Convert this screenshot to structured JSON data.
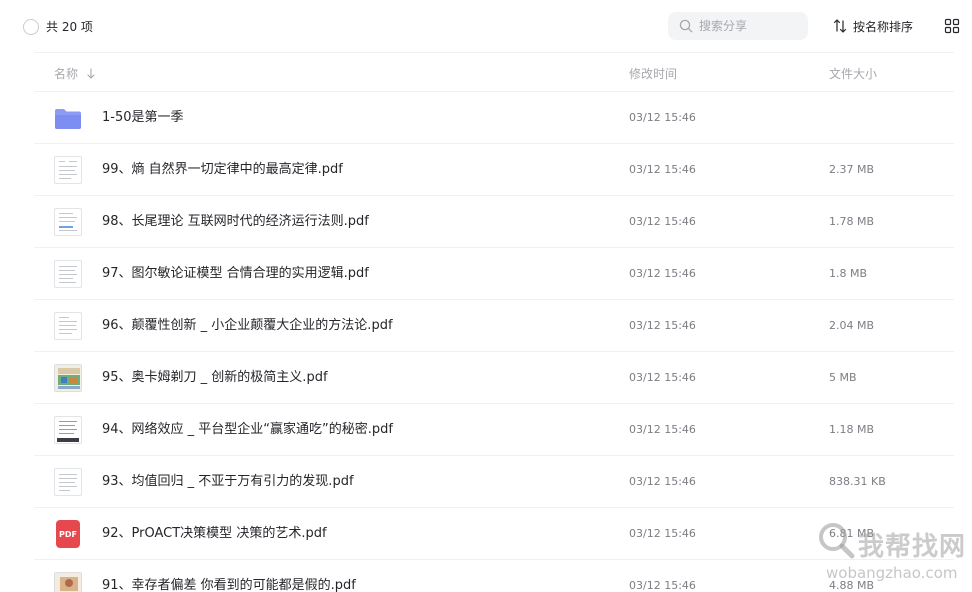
{
  "toolbar": {
    "count_label": "共 20 项",
    "search_placeholder": "搜索分享",
    "sort_label": "按名称排序"
  },
  "columns": {
    "name": "名称",
    "time": "修改时间",
    "size": "文件大小"
  },
  "files": [
    {
      "name": "1-50是第一季",
      "time": "03/12 15:46",
      "size": "",
      "icon": "folder-icon"
    },
    {
      "name": "99、熵 自然界一切定律中的最高定律.pdf",
      "time": "03/12 15:46",
      "size": "2.37 MB",
      "icon": "document-thumbnail-icon"
    },
    {
      "name": "98、长尾理论 互联网时代的经济运行法则.pdf",
      "time": "03/12 15:46",
      "size": "1.78 MB",
      "icon": "document-thumbnail-icon"
    },
    {
      "name": "97、图尔敏论证模型 合情合理的实用逻辑.pdf",
      "time": "03/12 15:46",
      "size": "1.8 MB",
      "icon": "document-thumbnail-icon"
    },
    {
      "name": "96、颠覆性创新 _ 小企业颠覆大企业的方法论.pdf",
      "time": "03/12 15:46",
      "size": "2.04 MB",
      "icon": "document-thumbnail-icon"
    },
    {
      "name": "95、奥卡姆剃刀 _ 创新的极简主义.pdf",
      "time": "03/12 15:46",
      "size": "5 MB",
      "icon": "photo-thumbnail-icon"
    },
    {
      "name": "94、网络效应 _ 平台型企业“赢家通吃”的秘密.pdf",
      "time": "03/12 15:46",
      "size": "1.18 MB",
      "icon": "document-thumbnail-icon"
    },
    {
      "name": "93、均值回归 _ 不亚于万有引力的发现.pdf",
      "time": "03/12 15:46",
      "size": "838.31 KB",
      "icon": "document-thumbnail-icon"
    },
    {
      "name": "92、PrOACT决策模型 决策的艺术.pdf",
      "time": "03/12 15:46",
      "size": "6.81 MB",
      "icon": "pdf-icon"
    },
    {
      "name": "91、幸存者偏差 你看到的可能都是假的.pdf",
      "time": "03/12 15:46",
      "size": "4.88 MB",
      "icon": "photo-thumbnail-icon"
    }
  ],
  "pdf_badge": "PDF",
  "watermark": {
    "text": "我帮找网",
    "url": "wobangzhao.com"
  },
  "colors": {
    "folder": "#8c9cf5",
    "pdf": "#e5484d",
    "text": "#25262b",
    "muted": "#a6a8ad",
    "divider": "#eef0f3"
  }
}
